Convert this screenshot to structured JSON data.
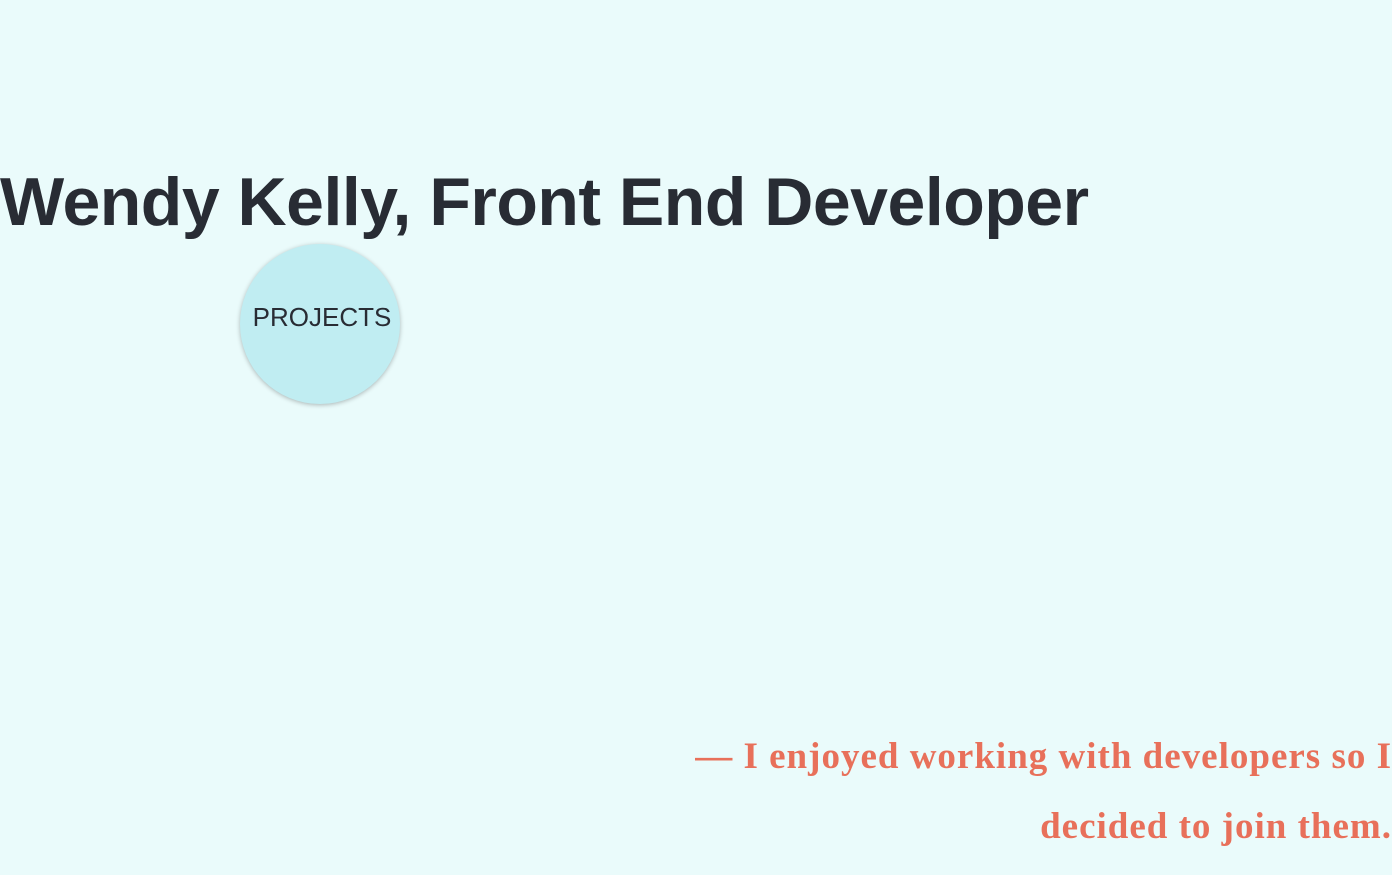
{
  "header": {
    "title": "Wendy Kelly, Front End Developer"
  },
  "nav": {
    "projects_label": "PROJECTS"
  },
  "quote": {
    "text": "— I enjoyed working with developers so I decided to join them."
  },
  "colors": {
    "background": "#eafbfb",
    "heading": "#282c34",
    "circle": "#c0edf2",
    "quote": "#e8705a"
  }
}
